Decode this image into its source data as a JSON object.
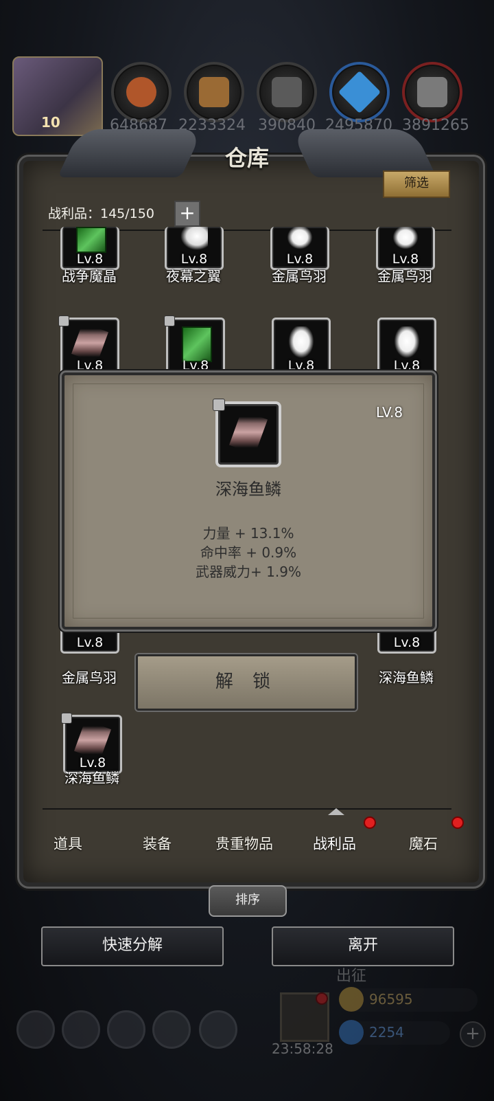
{
  "resources": [
    {
      "name": "meat-icon",
      "value": "648687",
      "color": "#b0562a"
    },
    {
      "name": "wood-icon",
      "value": "2233324",
      "color": "#9a6a34"
    },
    {
      "name": "stone-icon",
      "value": "390840",
      "color": "#6a6a6a"
    },
    {
      "name": "crystal-icon",
      "value": "2495870",
      "color": "#3a8fd6"
    },
    {
      "name": "iron-icon",
      "value": "3891265",
      "color": "#8a8a8a"
    }
  ],
  "player": {
    "level": "10"
  },
  "warehouse": {
    "title": "仓库",
    "filter_label": "筛选",
    "loot_count": "战利品：145/150",
    "plus_label": "+"
  },
  "grid": {
    "row1": [
      {
        "lv": "Lv.8",
        "name": "战争魔晶",
        "icon": "crystal"
      },
      {
        "lv": "Lv.8",
        "name": "夜幕之翼",
        "icon": "wing"
      },
      {
        "lv": "Lv.8",
        "name": "金属鸟羽",
        "icon": "feather"
      },
      {
        "lv": "Lv.8",
        "name": "金属鸟羽",
        "icon": "feather"
      }
    ],
    "row2": [
      {
        "lv": "Lv.8",
        "icon": "scale",
        "locked": true
      },
      {
        "lv": "Lv.8",
        "icon": "crystal",
        "locked": true
      },
      {
        "lv": "Lv.8",
        "icon": "feather"
      },
      {
        "lv": "Lv.8",
        "icon": "feather"
      }
    ],
    "row3": [
      {
        "lv": "Lv.8",
        "name": "金属鸟羽",
        "icon": "feather"
      },
      {
        "lv": "Lv.8",
        "name": "深海鱼鳞",
        "icon": "scale"
      }
    ],
    "row4": [
      {
        "lv": "Lv.8",
        "name": "深海鱼鳞",
        "icon": "scale",
        "locked": true
      }
    ]
  },
  "popup": {
    "level": "LV.8",
    "item_name": "深海鱼鳞",
    "stats": [
      "力量 + 13.1%",
      "命中率 + 0.9%",
      "武器威力+ 1.9%"
    ],
    "unlock_label": "解 锁"
  },
  "tabs": [
    {
      "label": "道具"
    },
    {
      "label": "装备"
    },
    {
      "label": "贵重物品"
    },
    {
      "label": "战利品",
      "active": true,
      "badge": true
    },
    {
      "label": "魔石",
      "badge": true
    }
  ],
  "sort_label": "排序",
  "quick_decompose_label": "快速分解",
  "leave_label": "离开",
  "background": {
    "expedition_label": "出征",
    "timer": "23:58:28",
    "gold": "96595",
    "gems": "2254"
  }
}
